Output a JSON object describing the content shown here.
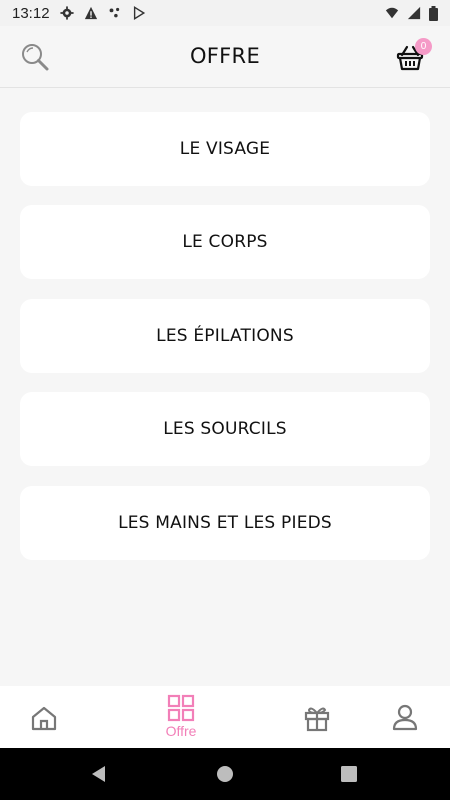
{
  "status_bar": {
    "time": "13:12",
    "icons": [
      "settings-icon",
      "warning-icon",
      "dots-icon",
      "play-store-icon",
      "wifi-icon",
      "signal-icon",
      "battery-icon"
    ]
  },
  "header": {
    "title": "OFFRE",
    "cart_count": "0",
    "icons": [
      "search-icon",
      "basket-icon"
    ]
  },
  "offers": [
    {
      "label": "LE VISAGE"
    },
    {
      "label": "LE CORPS"
    },
    {
      "label": "LES ÉPILATIONS"
    },
    {
      "label": "LES SOURCILS"
    },
    {
      "label": "LES MAINS ET LES PIEDS"
    }
  ],
  "bottom_nav": {
    "items": [
      {
        "icon": "home-icon",
        "label": ""
      },
      {
        "icon": "grid-icon",
        "label": "Offre",
        "active": true
      },
      {
        "icon": "gift-icon",
        "label": ""
      },
      {
        "icon": "user-icon",
        "label": ""
      }
    ]
  },
  "colors": {
    "accent": "#f27fb8",
    "badge": "#f59ac7",
    "background": "#f6f6f6",
    "card": "#ffffff"
  }
}
